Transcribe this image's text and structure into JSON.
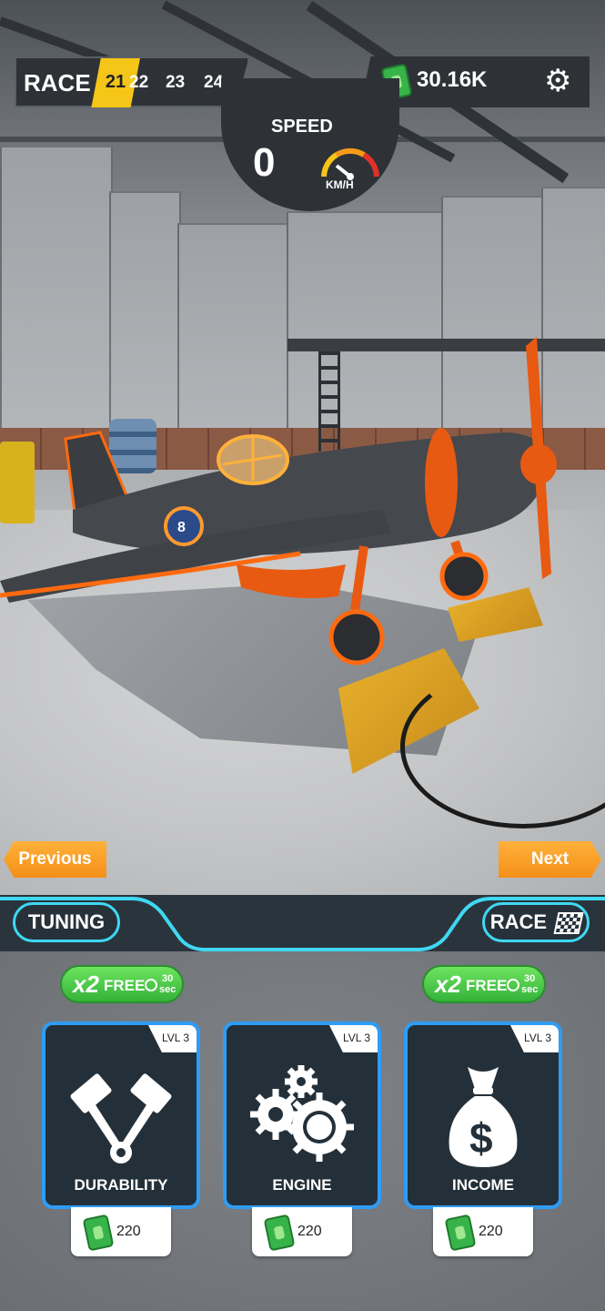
{
  "header": {
    "race_label": "RACE",
    "levels": [
      "21",
      "22",
      "23",
      "24"
    ],
    "current_level": "21",
    "cash": "30.16K"
  },
  "speed": {
    "label": "SPEED",
    "value": "0",
    "unit": "KM/H"
  },
  "navigation": {
    "previous_label": "Previous",
    "next_label": "Next"
  },
  "tabs": {
    "tuning_label": "TUNING",
    "race_label": "RACE"
  },
  "boosts": [
    {
      "multiplier": "x2",
      "label": "FREE",
      "time": "30",
      "unit": "sec"
    },
    {
      "multiplier": "x2",
      "label": "FREE",
      "time": "30",
      "unit": "sec"
    }
  ],
  "upgrades": [
    {
      "name": "DURABILITY",
      "level": "LVL 3",
      "price": "220",
      "icon": "pistons-icon"
    },
    {
      "name": "ENGINE",
      "level": "LVL 3",
      "price": "220",
      "icon": "gears-icon"
    },
    {
      "name": "INCOME",
      "level": "LVL 3",
      "price": "220",
      "icon": "money-bag-icon"
    }
  ],
  "colors": {
    "accent_yellow": "#f5c518",
    "button_orange": "#f48f18",
    "glow_orange": "#ff6a10",
    "card_border_blue": "#2f9cf5",
    "tab_cyan": "#3fd8f2",
    "free_green": "#34b23a",
    "hud_dark": "#2e3237"
  }
}
